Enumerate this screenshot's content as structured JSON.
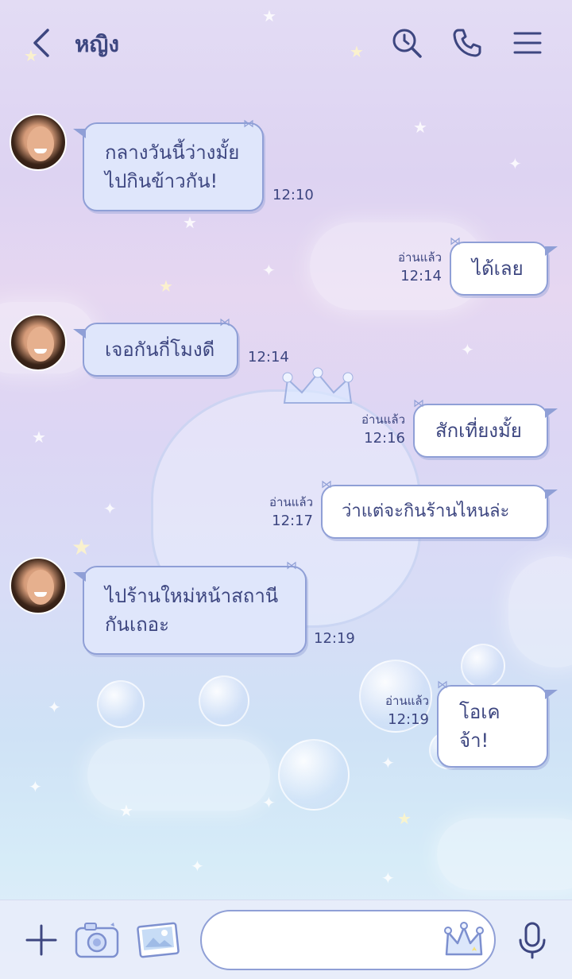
{
  "header": {
    "title": "หญิง"
  },
  "messages": [
    {
      "side": "in",
      "text": "กลางวันนี้ว่างมั้ย\nไปกินข้าวกัน!",
      "time": "12:10"
    },
    {
      "side": "out",
      "text": "ได้เลย",
      "read": "อ่านแล้ว",
      "time": "12:14"
    },
    {
      "side": "in",
      "text": "เจอกันกี่โมงดี",
      "time": "12:14"
    },
    {
      "side": "out",
      "text": "สักเที่ยงมั้ย",
      "read": "อ่านแล้ว",
      "time": "12:16"
    },
    {
      "side": "out",
      "text": "ว่าแต่จะกินร้านไหนล่ะ",
      "read": "อ่านแล้ว",
      "time": "12:17"
    },
    {
      "side": "in",
      "text": "ไปร้านใหม่หน้าสถานี\nกันเถอะ",
      "time": "12:19"
    },
    {
      "side": "out",
      "text": "โอเคจ้า!",
      "read": "อ่านแล้ว",
      "time": "12:19"
    }
  ],
  "composer": {
    "placeholder": ""
  },
  "icons": {
    "back": "chevron-left-icon",
    "search": "search-clock-icon",
    "call": "phone-icon",
    "menu": "hamburger-menu-icon",
    "plus": "plus-icon",
    "camera": "camera-icon",
    "image": "image-icon",
    "emoji": "crown-emoji-icon",
    "mic": "microphone-icon"
  },
  "colors": {
    "accent": "#3d4680",
    "bubble_border": "#8f9fd6",
    "incoming_bubble": "#dfe6fb",
    "outgoing_bubble": "#ffffff"
  }
}
